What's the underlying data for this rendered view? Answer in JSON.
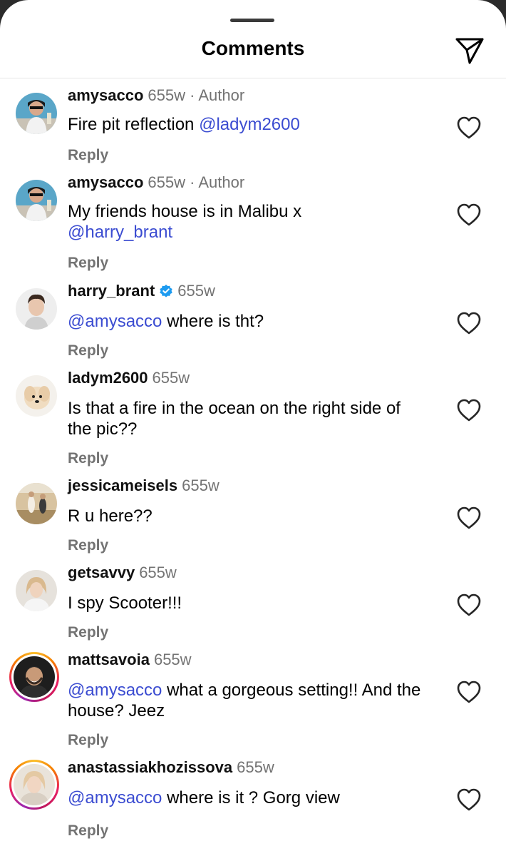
{
  "header": {
    "title": "Comments"
  },
  "reply_label": "Reply",
  "author_label": "Author",
  "colors": {
    "mention": "#3b4cd1",
    "verified": "#1d9bf0",
    "meta_gray": "#737373"
  },
  "comments": [
    {
      "username": "amysacco",
      "time": "655w",
      "author": true,
      "verified": false,
      "story_ring": false,
      "mention": "",
      "text": "Fire pit reflection ",
      "mention_after": "@ladym2600"
    },
    {
      "username": "amysacco",
      "time": "655w",
      "author": true,
      "verified": false,
      "story_ring": false,
      "mention": "",
      "text": "My friends house is in Malibu x",
      "mention_after": "@harry_brant"
    },
    {
      "username": "harry_brant",
      "time": "655w",
      "author": false,
      "verified": true,
      "story_ring": false,
      "mention": "@amysacco",
      "text": " where is tht?",
      "mention_after": ""
    },
    {
      "username": "ladym2600",
      "time": "655w",
      "author": false,
      "verified": false,
      "story_ring": false,
      "mention": "",
      "text": "Is that a fire in the ocean on the right side of the pic??",
      "mention_after": ""
    },
    {
      "username": "jessicameisels",
      "time": "655w",
      "author": false,
      "verified": false,
      "story_ring": false,
      "mention": "",
      "text": "R u here??",
      "mention_after": ""
    },
    {
      "username": "getsavvy",
      "time": "655w",
      "author": false,
      "verified": false,
      "story_ring": false,
      "mention": "",
      "text": "I spy Scooter!!!",
      "mention_after": ""
    },
    {
      "username": "mattsavoia",
      "time": "655w",
      "author": false,
      "verified": false,
      "story_ring": true,
      "mention": "@amysacco",
      "text": " what a gorgeous setting!! And the house? Jeez",
      "mention_after": ""
    },
    {
      "username": "anastassiakhozissova",
      "time": "655w",
      "author": false,
      "verified": false,
      "story_ring": true,
      "mention": "@amysacco",
      "text": " where is it ? Gorg view",
      "mention_after": ""
    }
  ]
}
